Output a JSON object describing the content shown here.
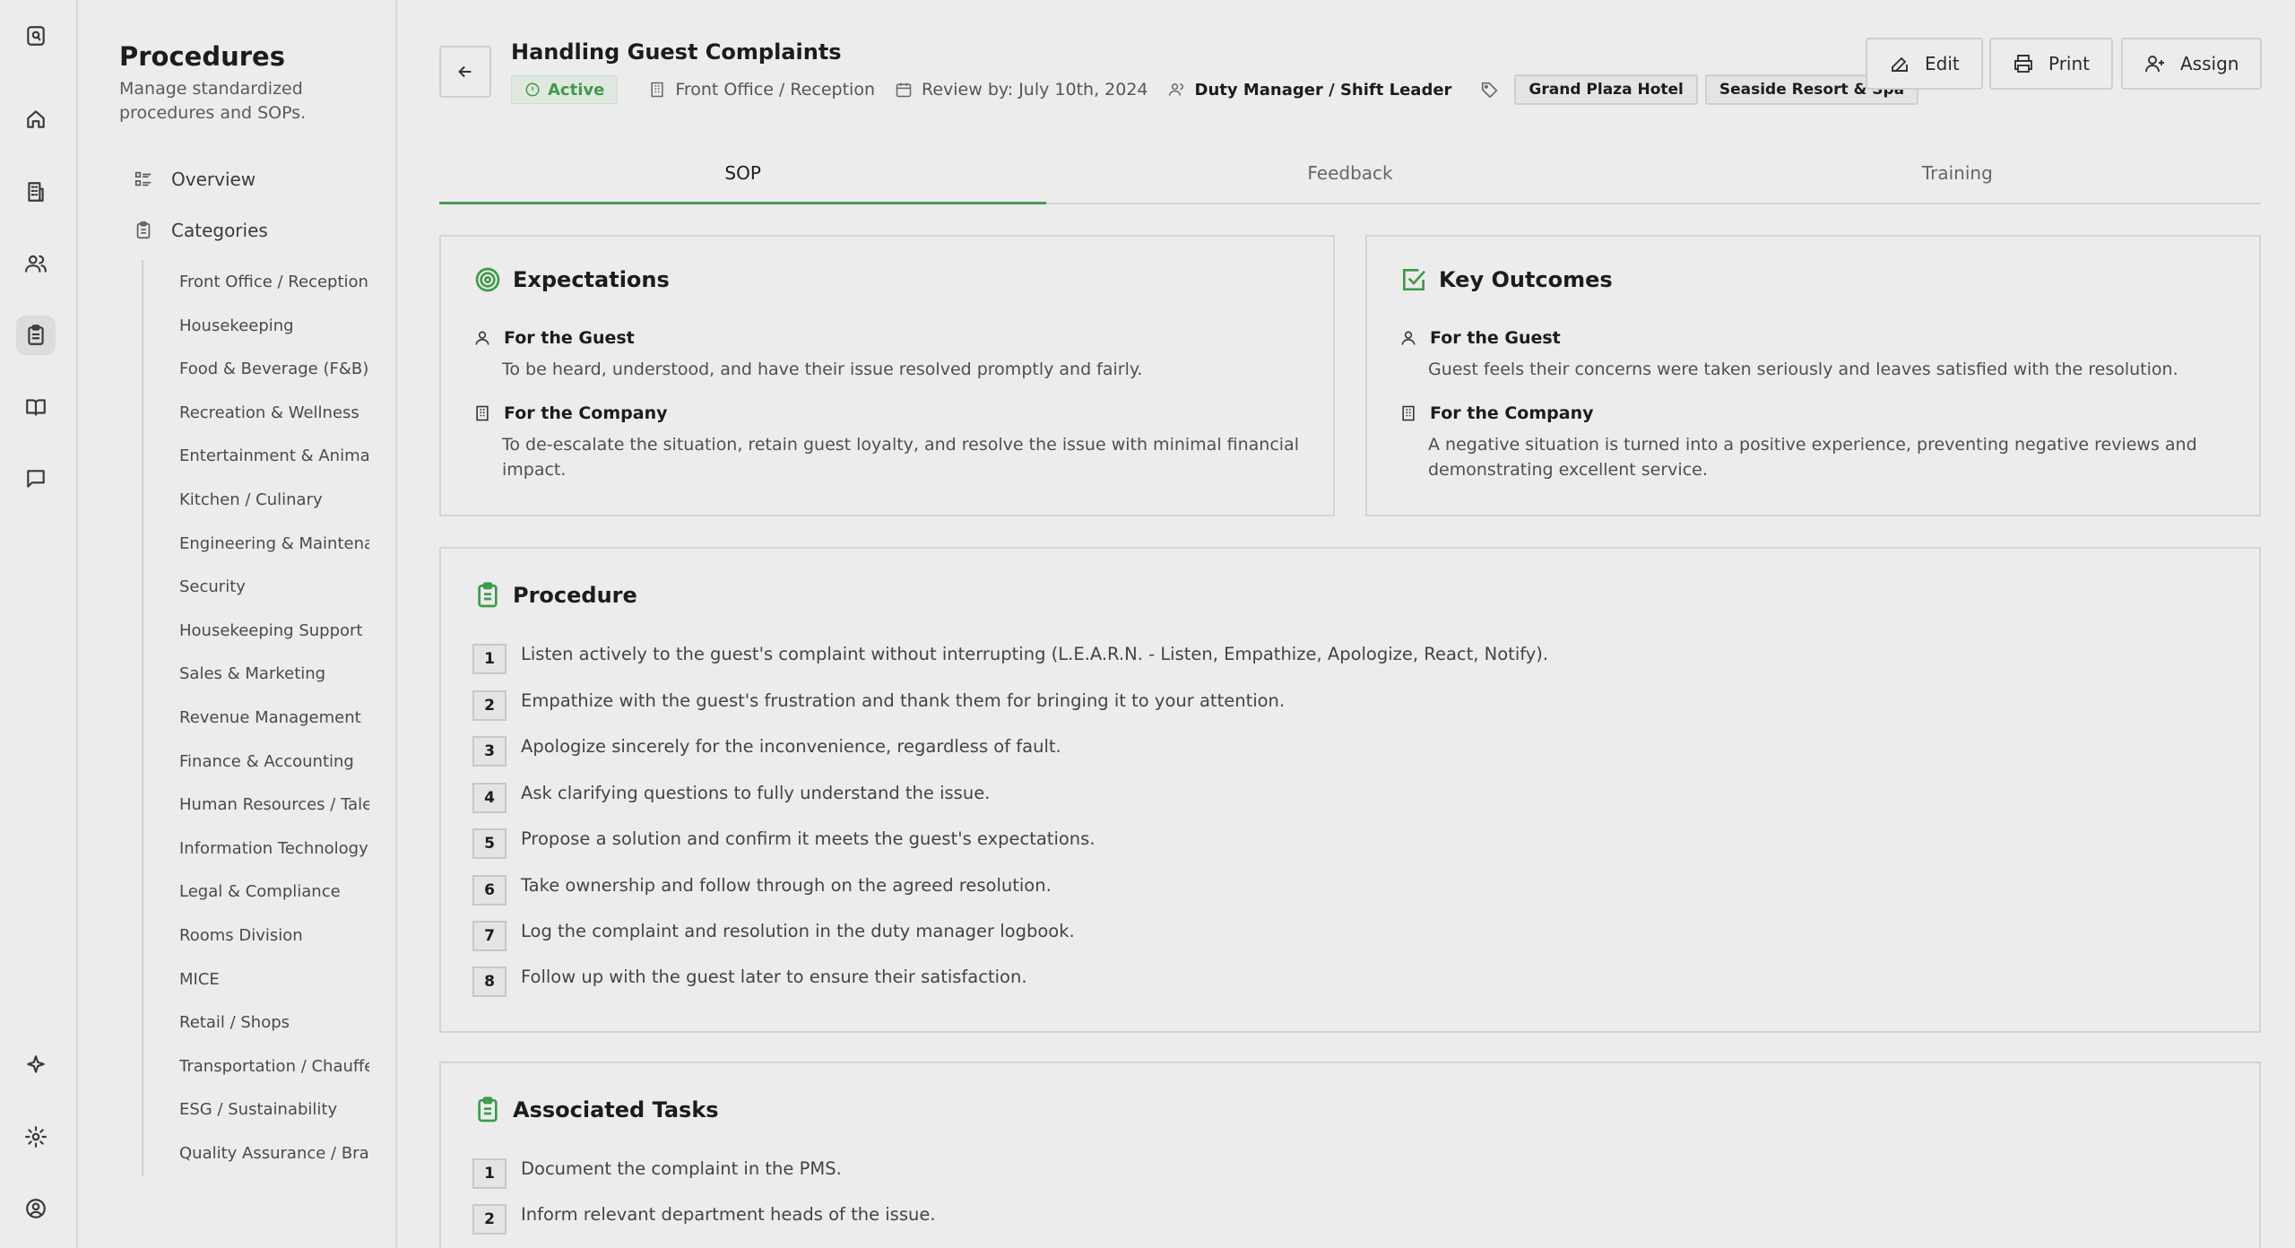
{
  "rail": {
    "icons": [
      "logo-icon",
      "home-icon",
      "building-icon",
      "users-icon",
      "clipboard-icon",
      "book-icon",
      "chat-icon",
      "sparkle-icon",
      "settings-icon",
      "account-icon"
    ]
  },
  "sidebar": {
    "title": "Procedures",
    "subtitle": "Manage standardized procedures and SOPs.",
    "nav": [
      {
        "label": "Overview",
        "icon": "list-icon"
      },
      {
        "label": "Categories",
        "icon": "clipboard-icon"
      }
    ],
    "categories": [
      "Front Office / Reception",
      "Housekeeping",
      "Food & Beverage (F&B)",
      "Recreation & Wellness",
      "Entertainment & Animation",
      "Kitchen / Culinary",
      "Engineering & Maintenance",
      "Security",
      "Housekeeping Support",
      "Sales & Marketing",
      "Revenue Management",
      "Finance & Accounting",
      "Human Resources / Talent",
      "Information Technology",
      "Legal & Compliance",
      "Rooms Division",
      "MICE",
      "Retail / Shops",
      "Transportation / Chauffeur",
      "ESG / Sustainability",
      "Quality Assurance / Brand"
    ]
  },
  "header": {
    "title": "Handling Guest Complaints",
    "status": "Active",
    "department": "Front Office / Reception",
    "review": "Review by: July 10th, 2024",
    "role": "Duty Manager / Shift Leader",
    "tags": [
      "Grand Plaza Hotel",
      "Seaside Resort & Spa"
    ],
    "actions": {
      "edit": "Edit",
      "print": "Print",
      "assign": "Assign"
    }
  },
  "tabs": [
    "SOP",
    "Feedback",
    "Training"
  ],
  "active_tab": "SOP",
  "expectations": {
    "title": "Expectations",
    "guest_label": "For the Guest",
    "guest_text": "To be heard, understood, and have their issue resolved promptly and fairly.",
    "company_label": "For the Company",
    "company_text": "To de-escalate the situation, retain guest loyalty, and resolve the issue with minimal financial impact."
  },
  "outcomes": {
    "title": "Key Outcomes",
    "guest_label": "For the Guest",
    "guest_text": "Guest feels their concerns were taken seriously and leaves satisfied with the resolution.",
    "company_label": "For the Company",
    "company_text": "A negative situation is turned into a positive experience, preventing negative reviews and demonstrating excellent service."
  },
  "procedure": {
    "title": "Procedure",
    "steps": [
      {
        "n": "1",
        "text": "Listen actively to the guest's complaint without interrupting (L.E.A.R.N. - Listen, Empathize, Apologize, React, Notify)."
      },
      {
        "n": "2",
        "text": "Empathize with the guest's frustration and thank them for bringing it to your attention."
      },
      {
        "n": "3",
        "text": "Apologize sincerely for the inconvenience, regardless of fault."
      },
      {
        "n": "4",
        "text": "Ask clarifying questions to fully understand the issue."
      },
      {
        "n": "5",
        "text": "Propose a solution and confirm it meets the guest's expectations."
      },
      {
        "n": "6",
        "text": "Take ownership and follow through on the agreed resolution."
      },
      {
        "n": "7",
        "text": "Log the complaint and resolution in the duty manager logbook."
      },
      {
        "n": "8",
        "text": "Follow up with the guest later to ensure their satisfaction."
      }
    ]
  },
  "tasks": {
    "title": "Associated Tasks",
    "steps": [
      {
        "n": "1",
        "text": "Document the complaint in the PMS."
      },
      {
        "n": "2",
        "text": "Inform relevant department heads of the issue."
      }
    ]
  },
  "colors": {
    "accent": "#3f9a4b",
    "background": "#ececec",
    "border": "#d4d4d4"
  }
}
